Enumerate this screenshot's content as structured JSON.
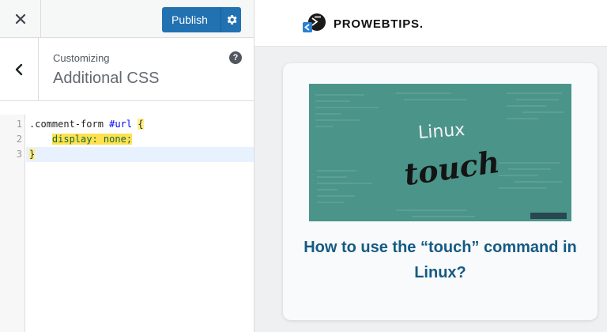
{
  "toolbar": {
    "publish_label": "Publish"
  },
  "section": {
    "crumb": "Customizing",
    "title": "Additional CSS",
    "help": "?"
  },
  "editor": {
    "line_numbers": [
      "1",
      "2",
      "3"
    ],
    "lines": [
      {
        "selector": ".comment-form ",
        "id": "#url",
        "space": " ",
        "brace": "{"
      },
      {
        "indent": "    ",
        "declaration": "display: none;"
      },
      {
        "brace": "}"
      }
    ]
  },
  "preview": {
    "site_name": "PROWEBTIPS.",
    "logo_glyph": ">",
    "post": {
      "thumb_word1": "Linux",
      "thumb_word2": "touch",
      "title": "How to use the “touch” command in Linux?"
    }
  },
  "colors": {
    "accent": "#2271b1",
    "highlight": "#ffe14d",
    "thumb_bg": "#4b948a",
    "title": "#155a83"
  },
  "icons": [
    "close-icon",
    "gear-icon",
    "chevron-left-icon",
    "help-icon",
    "terminal-logo-icon"
  ]
}
